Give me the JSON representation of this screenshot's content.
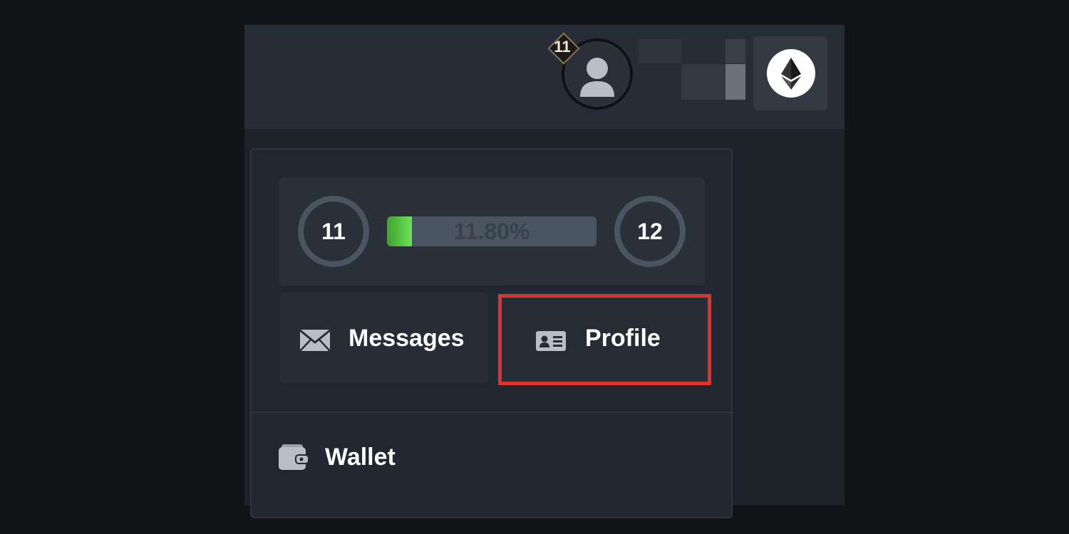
{
  "header": {
    "level_badge": "11",
    "avatar_icon": "user-icon",
    "currency_icon": "ethereum-icon"
  },
  "level_card": {
    "current_level": "11",
    "next_level": "12",
    "progress_label": "11.80%",
    "progress_fraction": 0.118,
    "progress_color": "#56c944"
  },
  "actions": {
    "messages_label": "Messages",
    "messages_icon": "envelope-icon",
    "profile_label": "Profile",
    "profile_icon": "id-card-icon"
  },
  "menu": {
    "wallet_label": "Wallet",
    "wallet_icon": "wallet-icon"
  },
  "colors": {
    "highlight": "#e0332c",
    "background": "#1d2128"
  }
}
